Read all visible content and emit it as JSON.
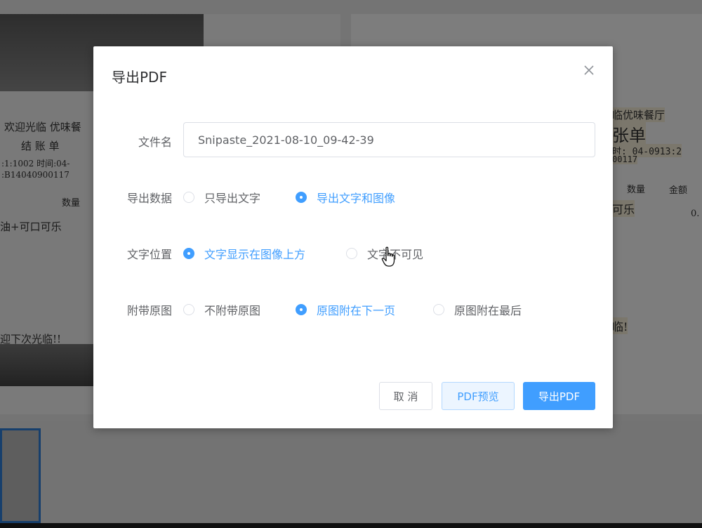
{
  "background": {
    "ocr_lines": [
      {
        "text": "临优味餐厅"
      },
      {
        "text": "张单"
      },
      {
        "text": "时: 04-0913:2"
      },
      {
        "text": "00117"
      },
      {
        "text": "数量"
      },
      {
        "text": "金额"
      },
      {
        "text": "可乐"
      },
      {
        "text": "0."
      },
      {
        "text": "临!"
      }
    ],
    "photo_lines": [
      {
        "text": "欢迎光临  优味餐"
      },
      {
        "text": "结  账  单"
      },
      {
        "text": ":1:1002    时间:04-"
      },
      {
        "text": ":B14040900117"
      },
      {
        "text": "数量"
      },
      {
        "text": "油+可口可乐"
      },
      {
        "text": "迎下次光临!!"
      }
    ]
  },
  "dialog": {
    "title": "导出PDF",
    "filename_label": "文件名",
    "filename_value": "Snipaste_2021-08-10_09-42-39",
    "export_data": {
      "label": "导出数据",
      "options": [
        "只导出文字",
        "导出文字和图像"
      ],
      "selected": 1
    },
    "text_position": {
      "label": "文字位置",
      "options": [
        "文字显示在图像上方",
        "文字不可见"
      ],
      "selected": 0
    },
    "attach_original": {
      "label": "附带原图",
      "options": [
        "不附带原图",
        "原图附在下一页",
        "原图附在最后"
      ],
      "selected": 1
    },
    "buttons": {
      "cancel": "取 消",
      "preview": "PDF预览",
      "export": "导出PDF"
    }
  },
  "colors": {
    "primary": "#409eff",
    "overlay": "rgba(0,0,0,0.5)"
  }
}
